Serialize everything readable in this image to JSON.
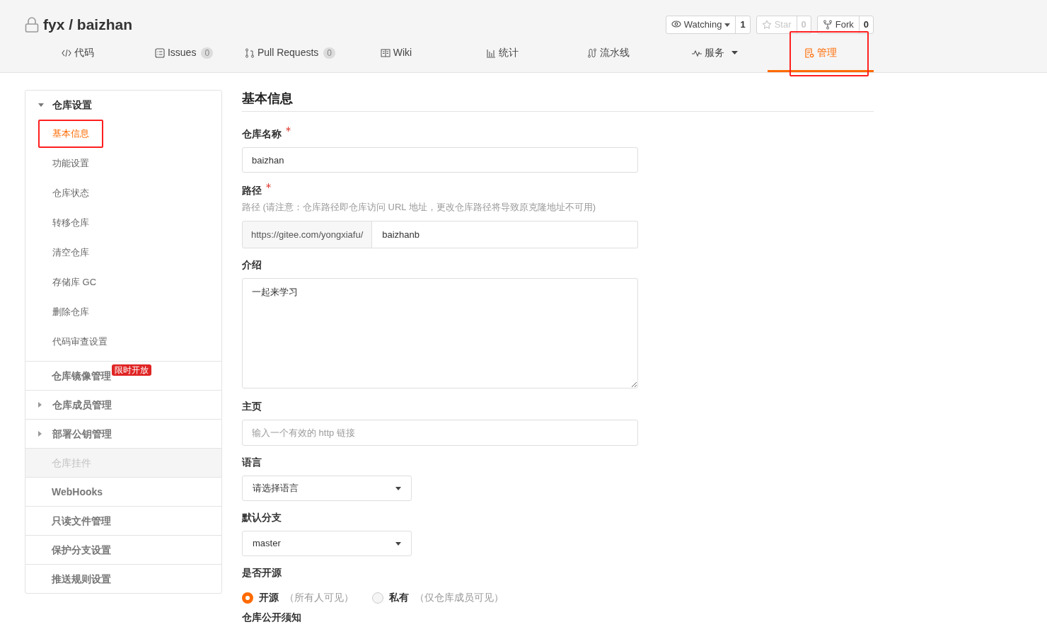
{
  "repo": {
    "owner": "fyx",
    "separator": "/",
    "name": "baizhan"
  },
  "actions": [
    {
      "label": "Watching",
      "count": "1",
      "disabled": false,
      "has_menu": true
    },
    {
      "label": "Star",
      "count": "0",
      "disabled": true,
      "has_menu": false
    },
    {
      "label": "Fork",
      "count": "0",
      "disabled": false,
      "has_menu": false
    }
  ],
  "tabs": [
    {
      "label": "代码",
      "selected": false,
      "has_menu": false,
      "highlighted": false
    },
    {
      "label": "Issues",
      "count": "0",
      "selected": false,
      "has_menu": false,
      "highlighted": false
    },
    {
      "label": "Pull Requests",
      "count": "0",
      "selected": false,
      "has_menu": false,
      "highlighted": false
    },
    {
      "label": "Wiki",
      "selected": false,
      "has_menu": false,
      "highlighted": false
    },
    {
      "label": "统计",
      "selected": false,
      "has_menu": false,
      "highlighted": false
    },
    {
      "label": "流水线",
      "selected": false,
      "has_menu": false,
      "highlighted": false
    },
    {
      "label": "服务",
      "selected": false,
      "has_menu": true,
      "highlighted": false
    },
    {
      "label": "管理",
      "selected": true,
      "has_menu": false,
      "highlighted": true
    }
  ],
  "sidebar": [
    {
      "kind": "group",
      "label": "仓库设置",
      "expanded": true,
      "disabled": false,
      "children": [
        {
          "label": "基本信息",
          "selected": true,
          "highlighted": true
        },
        {
          "label": "功能设置",
          "selected": false,
          "highlighted": false
        },
        {
          "label": "仓库状态",
          "selected": false,
          "highlighted": false
        },
        {
          "label": "转移仓库",
          "selected": false,
          "highlighted": false
        },
        {
          "label": "清空仓库",
          "selected": false,
          "highlighted": false
        },
        {
          "label": "存储库 GC",
          "selected": false,
          "highlighted": false
        },
        {
          "label": "删除仓库",
          "selected": false,
          "highlighted": false
        },
        {
          "label": "代码审查设置",
          "selected": false,
          "highlighted": false
        }
      ]
    },
    {
      "kind": "link",
      "label": "仓库镜像管理",
      "badge": "限时开放",
      "disabled": false
    },
    {
      "kind": "group",
      "label": "仓库成员管理",
      "expanded": false,
      "disabled": false
    },
    {
      "kind": "group",
      "label": "部署公钥管理",
      "expanded": false,
      "disabled": false
    },
    {
      "kind": "link",
      "label": "仓库挂件",
      "disabled": true
    },
    {
      "kind": "link",
      "label": "WebHooks",
      "disabled": false
    },
    {
      "kind": "link",
      "label": "只读文件管理",
      "disabled": false
    },
    {
      "kind": "link",
      "label": "保护分支设置",
      "disabled": false
    },
    {
      "kind": "link",
      "label": "推送规则设置",
      "disabled": false
    }
  ],
  "form": {
    "title": "基本信息",
    "name": {
      "label": "仓库名称",
      "required": true,
      "value": "baizhan"
    },
    "path": {
      "label": "路径",
      "required": true,
      "hint": "路径 (请注意：仓库路径即仓库访问 URL 地址，更改仓库路径将导致原克隆地址不可用)",
      "prefix": "https://gitee.com/yongxiafu/",
      "value": "baizhanb"
    },
    "description": {
      "label": "介绍",
      "value": "一起来学习"
    },
    "homepage": {
      "label": "主页",
      "placeholder": "输入一个有效的 http 链接"
    },
    "language": {
      "label": "语言",
      "value": "请选择语言"
    },
    "default_branch": {
      "label": "默认分支",
      "value": "master"
    },
    "visibility": {
      "label": "是否开源",
      "options": [
        {
          "label": "开源",
          "note": "（所有人可见）",
          "selected": true
        },
        {
          "label": "私有",
          "note": "（仅仓库成员可见）",
          "selected": false
        }
      ]
    },
    "notice": {
      "label": "仓库公开须知"
    }
  }
}
